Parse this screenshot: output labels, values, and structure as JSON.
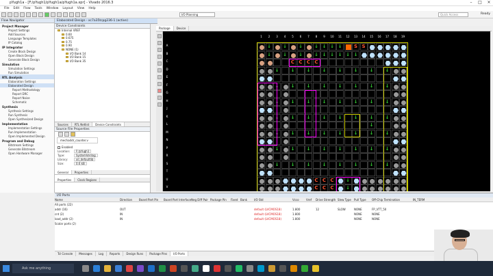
{
  "window": {
    "title": "pYugh1a - [F:/pYugh1/pYugh1a/pYugh1a.xpr] - Vivado 2016.3",
    "status": "Ready"
  },
  "menu": [
    "File",
    "Edit",
    "Flow",
    "Tools",
    "Window",
    "Layout",
    "View",
    "Help"
  ],
  "toolbar": {
    "layout": "I/O Planning",
    "search_placeholder": "Quick Access"
  },
  "flow_navigator": {
    "title": "Flow Navigator",
    "sections": [
      {
        "label": "Project Manager",
        "items": [
          "Project Settings",
          "Add Sources",
          "Language Templates",
          "IP Catalog"
        ]
      },
      {
        "label": "IP Integrator",
        "items": [
          "Create Block Design",
          "Open Block Design",
          "Generate Block Design"
        ]
      },
      {
        "label": "Simulation",
        "items": [
          "Simulation Settings",
          "Run Simulation"
        ]
      },
      {
        "label": "RTL Analysis",
        "items": [
          "Elaboration Settings",
          "Elaborated Design",
          "Report Methodology",
          "Report DRC",
          "Report Noise",
          "Schematic"
        ]
      },
      {
        "label": "Synthesis",
        "items": [
          "Synthesis Settings",
          "Run Synthesis",
          "Open Synthesized Design"
        ]
      },
      {
        "label": "Implementation",
        "items": [
          "Implementation Settings",
          "Run Implementation",
          "Open Implemented Design"
        ]
      },
      {
        "label": "Program and Debug",
        "items": [
          "Bitstream Settings",
          "Generate Bitstream",
          "Open Hardware Manager"
        ]
      }
    ]
  },
  "elaborated": {
    "title": "Elaborated Design - xc7a35tcpg236-1 (active)"
  },
  "device_constraints": {
    "title": "Device Constraints",
    "items": [
      "Internal VREF",
      "0.60",
      "0.675",
      "0.75",
      "0.90",
      "NONE (1)",
      "I/O Bank 14",
      "I/O Bank 15",
      "I/O Bank 35"
    ]
  },
  "source_props": {
    "tabs": [
      "Sources",
      "RTL Netlist",
      "Device Constraints"
    ],
    "title": "Source File Properties",
    "file": "mechaddr_counter.v",
    "enabled_label": "Enabled",
    "props": [
      [
        "Location:",
        "F:/pYugh1"
      ],
      [
        "Type:",
        "SystemVerilog"
      ],
      [
        "Library:",
        "xil_defaultlib"
      ],
      [
        "Size:",
        "0.6 kB"
      ]
    ],
    "subtabs": [
      "General",
      "Properties"
    ],
    "bottom_tabs": [
      "Properties",
      "Clock Regions"
    ]
  },
  "package": {
    "tabs": [
      "Package",
      "Device"
    ]
  },
  "io_ports": {
    "title": "I/O Ports",
    "headers": [
      "Name",
      "Direction",
      "Board Part Pin",
      "Board Part Interface",
      "Neg Diff Pair",
      "Package Pin",
      "Fixed",
      "Bank",
      "I/O Std",
      "Vcco",
      "Vref",
      "Drive Strength",
      "Slew Type",
      "Pull Type",
      "Off-Chip Termination",
      "IN_TERM"
    ],
    "rows": [
      [
        "All ports (22)",
        "",
        "",
        "",
        "",
        "",
        "",
        "",
        "",
        "",
        "",
        "",
        "",
        "",
        "",
        ""
      ],
      [
        "  addr (16)",
        "OUT",
        "",
        "",
        "",
        "",
        "",
        "",
        "default (LVCMOS18)",
        "1.800",
        "",
        "12",
        "SLOW",
        "NONE",
        "FP_VTT_50",
        ""
      ],
      [
        "  cnt (2)",
        "IN",
        "",
        "",
        "",
        "",
        "",
        "",
        "default (LVCMOS18)",
        "1.800",
        "",
        "",
        "",
        "NONE",
        "NONE",
        ""
      ],
      [
        "  load_addr (2)",
        "IN",
        "",
        "",
        "",
        "",
        "",
        "",
        "default (LVCMOS18)",
        "1.800",
        "",
        "",
        "",
        "NONE",
        "NONE",
        ""
      ],
      [
        "Scalar ports (2)",
        "",
        "",
        "",
        "",
        "",
        "",
        "",
        "",
        "",
        "",
        "",
        "",
        "",
        "",
        ""
      ]
    ]
  },
  "bottom_tabs": [
    "Tcl Console",
    "Messages",
    "Log",
    "Reports",
    "Design Runs",
    "Package Pins",
    "I/O Ports"
  ],
  "taskbar": {
    "search": "Ask me anything"
  }
}
